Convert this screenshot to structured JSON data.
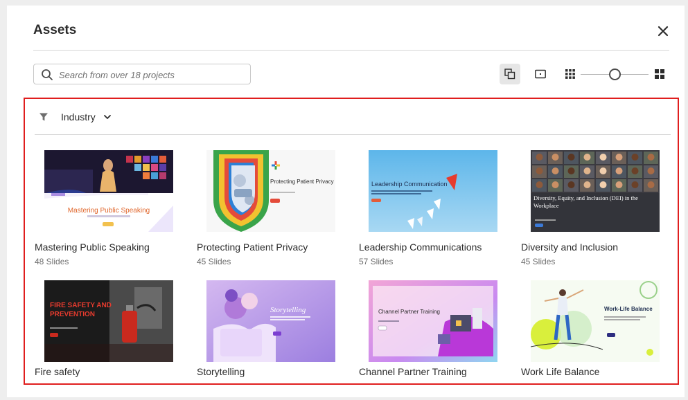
{
  "dialog": {
    "title": "Assets",
    "close_icon": "close-icon"
  },
  "search": {
    "placeholder": "Search from over 18 projects",
    "icon": "search-icon"
  },
  "toolbar": {
    "buttons": [
      {
        "icon": "copy-layers-icon",
        "active": true
      },
      {
        "icon": "slide-preview-icon",
        "active": false
      },
      {
        "icon": "small-grid-icon",
        "active": false
      },
      {
        "icon": "large-grid-icon",
        "active": false
      }
    ],
    "size_level": 0.5
  },
  "filter": {
    "label": "Industry",
    "icon": "filter-icon"
  },
  "projects": [
    {
      "name": "Mastering Public Speaking",
      "slides": "48 Slides",
      "thumb_title": "Mastering Public Speaking"
    },
    {
      "name": "Protecting Patient Privacy",
      "slides": "45 Slides",
      "thumb_title": "Protecting Patient Privacy"
    },
    {
      "name": "Leadership Communications",
      "slides": "57 Slides",
      "thumb_title": "Leadership Communication"
    },
    {
      "name": "Diversity and Inclusion",
      "slides": "45 Slides",
      "thumb_title": "Diversity, Equity, and Inclusion (DEI) in the Workplace"
    },
    {
      "name": "Fire safety",
      "thumb_title": "FIRE SAFETY AND PREVENTION"
    },
    {
      "name": "Storytelling",
      "thumb_title": "Storytelling"
    },
    {
      "name": "Channel Partner Training",
      "thumb_title": "Channel Partner Training"
    },
    {
      "name": "Work Life Balance",
      "thumb_title": "Work-Life Balance"
    }
  ],
  "colors": {
    "selection_border": "#e01e1e",
    "text": "#2c2c2c",
    "muted": "#6e6e6e"
  }
}
